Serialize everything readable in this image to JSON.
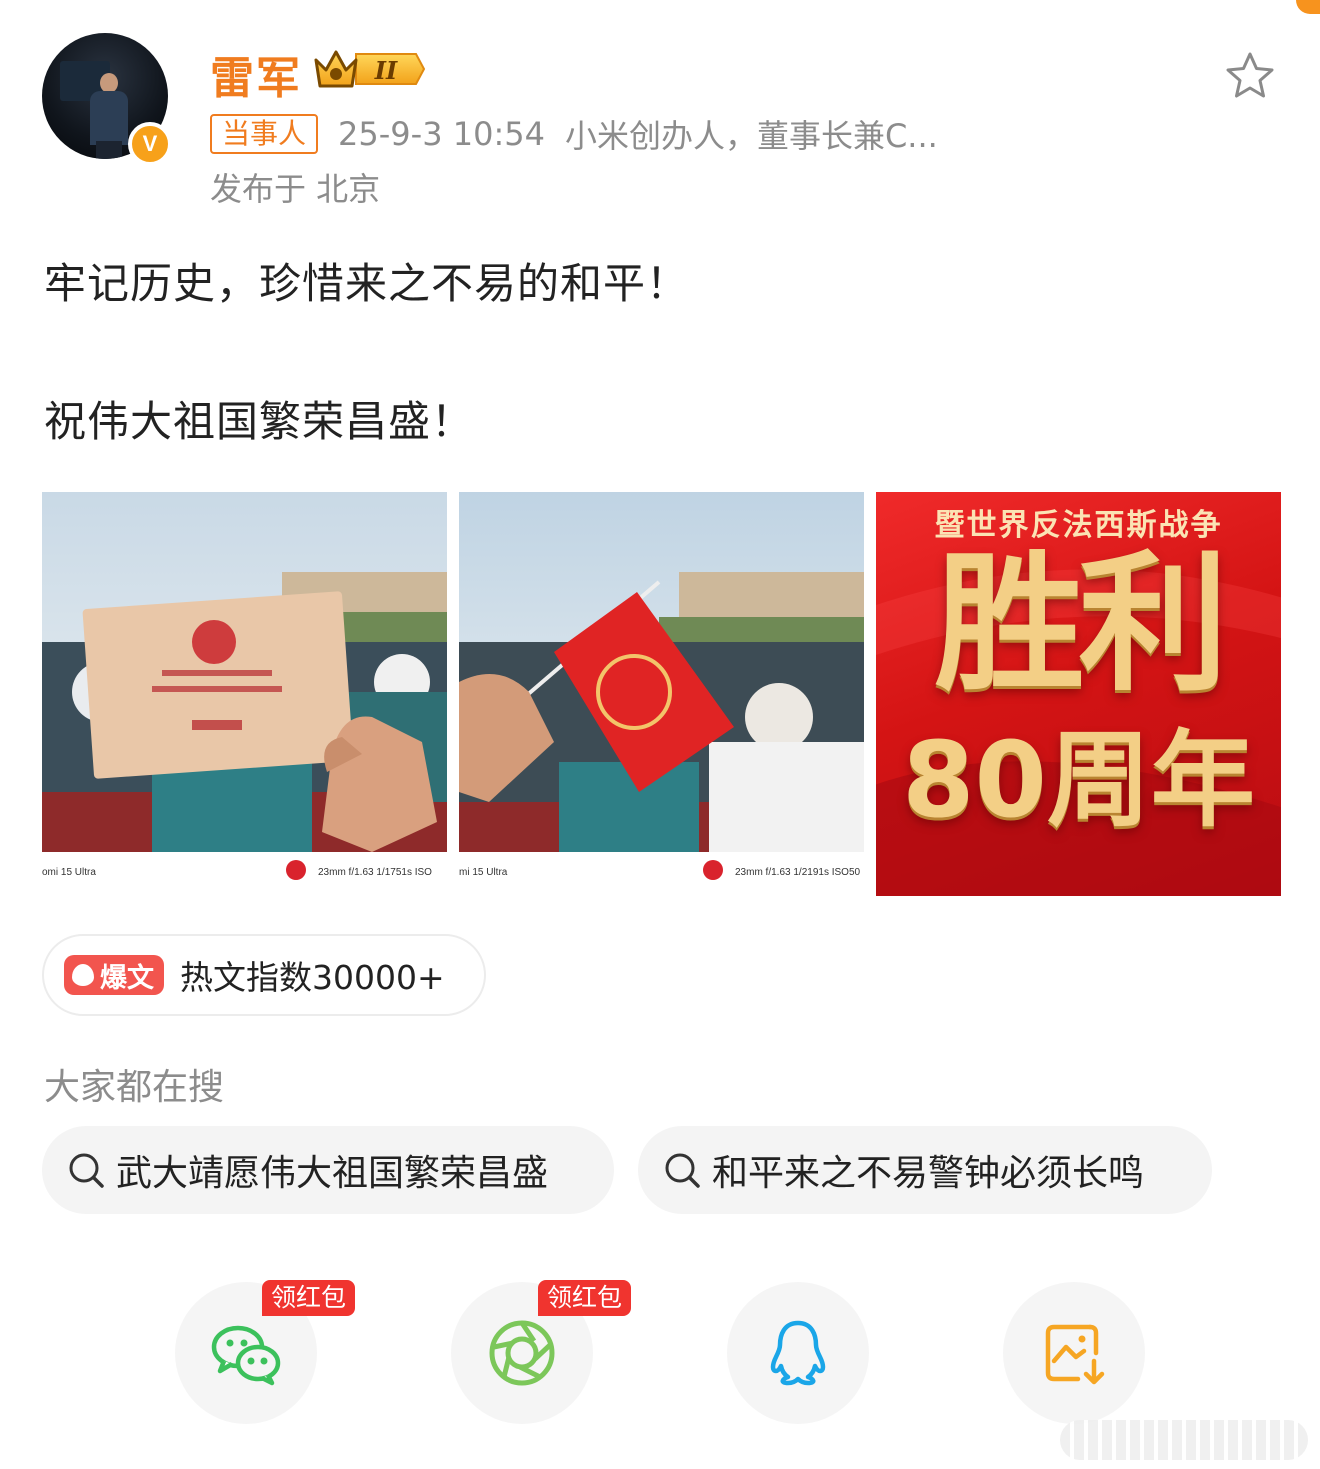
{
  "header": {
    "username": "雷军",
    "rank_badge": "II",
    "tag": "当事人",
    "time": "25-9-3 10:54",
    "description": "小米创办人，董事长兼C...",
    "location": "发布于 北京",
    "verified_mark": "V"
  },
  "post": {
    "line1": "牢记历史，珍惜来之不易的和平！",
    "line2": "祝伟大祖国繁荣昌盛！"
  },
  "images": [
    {
      "caption_model": "omi 15 Ultra",
      "caption_spec": "23mm  f/1.63  1/1751s  ISO"
    },
    {
      "caption_model": "mi 15 Ultra",
      "caption_spec": "23mm  f/1.63  1/2191s  ISO50"
    },
    {
      "poster_top": "暨世界反法西斯战争",
      "poster_big": "胜利",
      "poster_year": "80周年"
    }
  ],
  "hot": {
    "badge": "爆文",
    "text": "热文指数30000+"
  },
  "search": {
    "title": "大家都在搜",
    "chips": [
      "武大靖愿伟大祖国繁荣昌盛",
      "和平来之不易警钟必须长鸣"
    ]
  },
  "share": {
    "red_packet_label": "领红包",
    "targets": [
      "wechat-icon",
      "moments-icon",
      "qq-icon",
      "save-image-icon"
    ]
  },
  "colors": {
    "accent": "#f07c1f",
    "hot_red": "#f2554e",
    "wechat_green": "#3cc15c",
    "qq_blue": "#1aa6e8",
    "save_orange": "#f6a623"
  }
}
